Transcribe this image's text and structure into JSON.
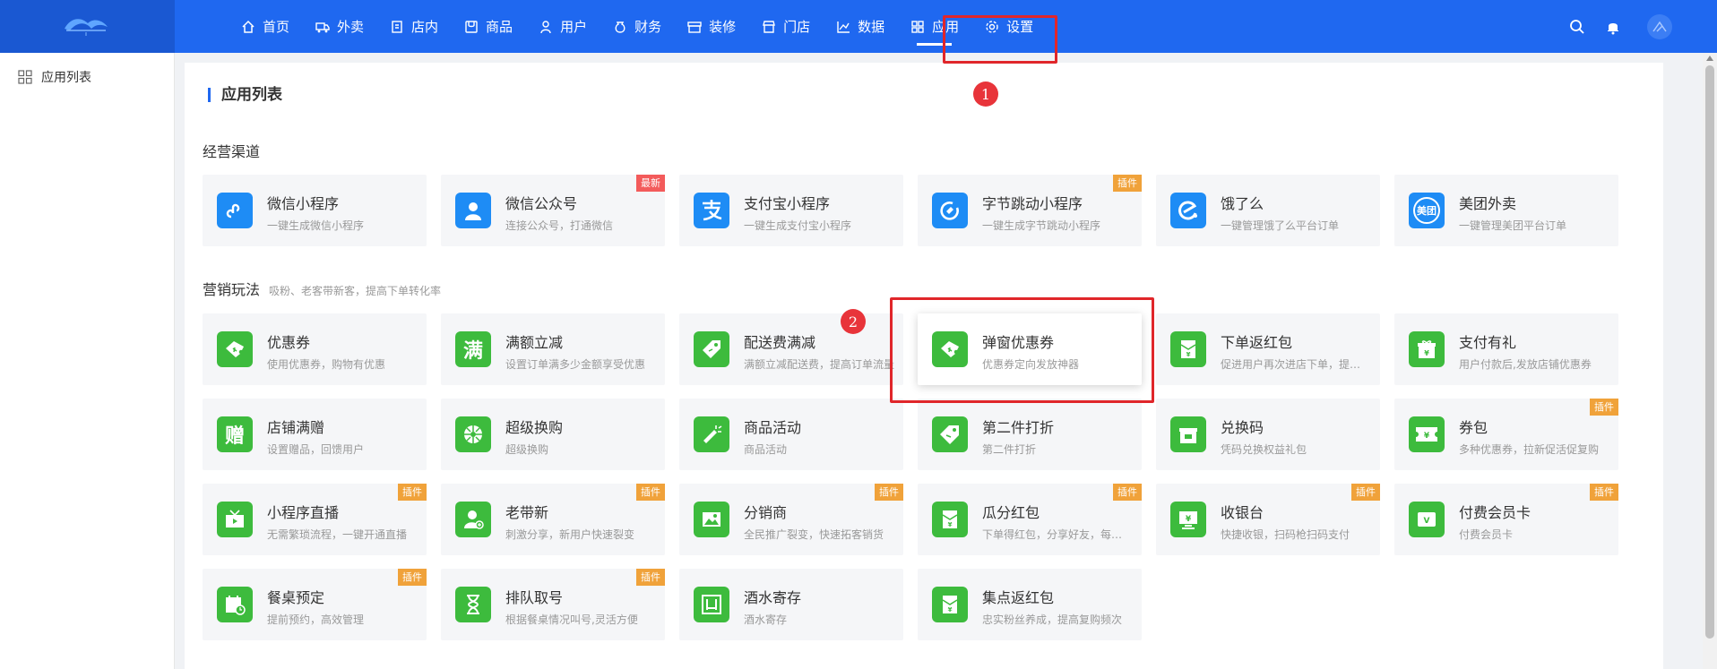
{
  "colors": {
    "topbar": "#1f68f0",
    "accent": "#1f68f0",
    "icon_blue": "#1e8cf5",
    "icon_green": "#3dbb3d",
    "tag_orange": "#f0a23a",
    "tag_red": "#f35b5b",
    "highlight": "#e0262a"
  },
  "nav": [
    {
      "label": "首页",
      "icon": "home-icon"
    },
    {
      "label": "外卖",
      "icon": "delivery-icon"
    },
    {
      "label": "店内",
      "icon": "dine-in-icon"
    },
    {
      "label": "商品",
      "icon": "product-icon"
    },
    {
      "label": "用户",
      "icon": "user-icon"
    },
    {
      "label": "财务",
      "icon": "finance-icon"
    },
    {
      "label": "装修",
      "icon": "decoration-icon"
    },
    {
      "label": "门店",
      "icon": "store-icon"
    },
    {
      "label": "数据",
      "icon": "chart-icon"
    },
    {
      "label": "应用",
      "icon": "apps-icon",
      "active": true
    },
    {
      "label": "设置",
      "icon": "gear-icon"
    }
  ],
  "sidebar": {
    "items": [
      {
        "label": "应用列表",
        "icon": "apps-grid-icon"
      }
    ]
  },
  "page": {
    "title": "应用列表"
  },
  "sections": {
    "channels": {
      "title": "经营渠道",
      "subtitle": ""
    },
    "marketing": {
      "title": "营销玩法",
      "subtitle": "吸粉、老客带新客，提高下单转化率"
    }
  },
  "cards": [
    {
      "title": "微信小程序",
      "desc": "一键生成微信小程序",
      "tag": "",
      "icon": "mini-program-icon"
    },
    {
      "title": "微信公众号",
      "desc": "连接公众号，打通微信",
      "tag": "最新",
      "icon": "official-account-icon"
    },
    {
      "title": "支付宝小程序",
      "desc": "一键生成支付宝小程序",
      "tag": "",
      "icon": "alipay-icon"
    },
    {
      "title": "字节跳动小程序",
      "desc": "一键生成字节跳动小程序",
      "tag": "插件",
      "icon": "bytedance-icon"
    },
    {
      "title": "饿了么",
      "desc": "一键管理饿了么平台订单",
      "tag": "",
      "icon": "eleme-icon"
    },
    {
      "title": "美团外卖",
      "desc": "一键管理美团平台订单",
      "tag": "",
      "icon": "meituan-icon",
      "icon_text": "美团"
    },
    {
      "title": "优惠券",
      "desc": "使用优惠券，购物有优惠",
      "tag": "",
      "icon": "coupon-icon"
    },
    {
      "title": "满额立减",
      "desc": "设置订单满多少金额享受优惠",
      "tag": "",
      "icon": "full-reduction-icon",
      "icon_text": "满"
    },
    {
      "title": "配送费满减",
      "desc": "满额立减配送费，提高订单流量",
      "tag": "",
      "icon": "delivery-fee-icon"
    },
    {
      "title": "弹窗优惠券",
      "desc": "优惠券定向发放神器",
      "tag": "",
      "icon": "popup-coupon-icon"
    },
    {
      "title": "下单返红包",
      "desc": "促进用户再次进店下单，提升复购",
      "tag": "",
      "icon": "order-red-packet-icon"
    },
    {
      "title": "支付有礼",
      "desc": "用户付款后,发放店铺优惠券",
      "tag": "",
      "icon": "pay-gift-icon"
    },
    {
      "title": "店铺满赠",
      "desc": "设置赠品，回馈用户",
      "tag": "",
      "icon": "store-gift-icon",
      "icon_text": "赠"
    },
    {
      "title": "超级换购",
      "desc": "超级换购",
      "tag": "",
      "icon": "super-exchange-icon"
    },
    {
      "title": "商品活动",
      "desc": "商品活动",
      "tag": "",
      "icon": "product-activity-icon"
    },
    {
      "title": "第二件打折",
      "desc": "第二件打折",
      "tag": "",
      "icon": "second-discount-icon"
    },
    {
      "title": "兑换码",
      "desc": "凭码兑换权益礼包",
      "tag": "",
      "icon": "redeem-code-icon"
    },
    {
      "title": "券包",
      "desc": "多种优惠券，拉新促活促复购",
      "tag": "插件",
      "icon": "coupon-pack-icon"
    },
    {
      "title": "小程序直播",
      "desc": "无需繁琐流程，一键开通直播",
      "tag": "插件",
      "icon": "live-stream-icon"
    },
    {
      "title": "老带新",
      "desc": "刺激分享，新用户快速裂变",
      "tag": "插件",
      "icon": "referral-icon"
    },
    {
      "title": "分销商",
      "desc": "全民推广裂变，快速拓客销货",
      "tag": "插件",
      "icon": "distributor-icon"
    },
    {
      "title": "瓜分红包",
      "desc": "下单得红包，分享好友，每人领取",
      "tag": "插件",
      "icon": "split-red-packet-icon"
    },
    {
      "title": "收银台",
      "desc": "快捷收银，扫码枪扫码支付",
      "tag": "插件",
      "icon": "cashier-icon"
    },
    {
      "title": "付费会员卡",
      "desc": "付费会员卡",
      "tag": "插件",
      "icon": "vip-card-icon"
    },
    {
      "title": "餐桌预定",
      "desc": "提前预约，高效管理",
      "tag": "插件",
      "icon": "table-booking-icon"
    },
    {
      "title": "排队取号",
      "desc": "根据餐桌情况叫号,灵活方便",
      "tag": "插件",
      "icon": "queue-icon"
    },
    {
      "title": "酒水寄存",
      "desc": "酒水寄存",
      "tag": "",
      "icon": "wine-storage-icon"
    },
    {
      "title": "集点返红包",
      "desc": "忠实粉丝养成，提高复购频次",
      "tag": "",
      "icon": "points-red-packet-icon"
    }
  ],
  "annotations": [
    {
      "label": "1"
    },
    {
      "label": "2"
    }
  ]
}
